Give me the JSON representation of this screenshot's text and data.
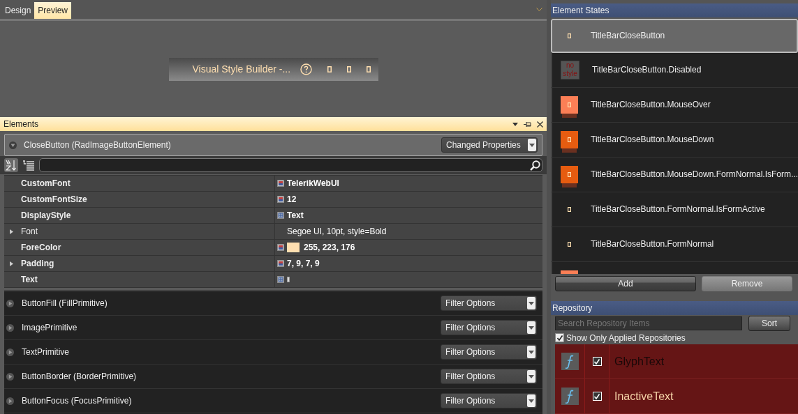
{
  "tabs": [
    {
      "label": "Design",
      "selected": false
    },
    {
      "label": "Preview",
      "selected": true
    }
  ],
  "preview": {
    "title": "Visual Style Builder -..."
  },
  "elements_panel": {
    "title": "Elements",
    "element": {
      "name": "CloseButton (RadImageButtonElement)",
      "expanded": true,
      "filter": "Changed Properties"
    },
    "properties": [
      {
        "name": "CustomFont",
        "modified": true,
        "expandable": false,
        "kind": "local",
        "value": "TelerikWebUI"
      },
      {
        "name": "CustomFontSize",
        "modified": true,
        "expandable": false,
        "kind": "local",
        "value": "12"
      },
      {
        "name": "DisplayStyle",
        "modified": true,
        "expandable": false,
        "kind": "theme",
        "value": "Text"
      },
      {
        "name": "Font",
        "modified": false,
        "expandable": true,
        "kind": "plain",
        "value": "Segoe UI, 10pt, style=Bold"
      },
      {
        "name": "ForeColor",
        "modified": true,
        "expandable": false,
        "kind": "local",
        "value": "255, 223, 176",
        "color": "#ffdfb0"
      },
      {
        "name": "Padding",
        "modified": true,
        "expandable": true,
        "kind": "local",
        "value": "7, 9, 7, 9"
      },
      {
        "name": "Text",
        "modified": true,
        "expandable": false,
        "kind": "theme",
        "glyph": true
      }
    ],
    "primitives": [
      {
        "name": "ButtonFill (FillPrimitive)",
        "filter": "Filter Options"
      },
      {
        "name": "ImagePrimitive",
        "filter": "Filter Options"
      },
      {
        "name": "TextPrimitive",
        "filter": "Filter Options"
      },
      {
        "name": "ButtonBorder (BorderPrimitive)",
        "filter": "Filter Options"
      },
      {
        "name": "ButtonFocus (FocusPrimitive)",
        "filter": "Filter Options"
      }
    ]
  },
  "element_states": {
    "title": "Element States",
    "items": [
      {
        "label": "TitleBarCloseButton",
        "kind": "plain",
        "selected": true
      },
      {
        "label": "TitleBarCloseButton.Disabled",
        "kind": "nostyle",
        "thumb_text": "no style",
        "selected": false
      },
      {
        "label": "TitleBarCloseButton.MouseOver",
        "kind": "light",
        "selected": false
      },
      {
        "label": "TitleBarCloseButton.MouseDown",
        "kind": "dark",
        "selected": false
      },
      {
        "label": "TitleBarCloseButton.MouseDown.FormNormal.IsForm...",
        "kind": "dark",
        "selected": false
      },
      {
        "label": "TitleBarCloseButton.FormNormal.IsFormActive",
        "kind": "plain",
        "selected": false
      },
      {
        "label": "TitleBarCloseButton.FormNormal",
        "kind": "plain",
        "selected": false
      },
      {
        "kind": "light",
        "selected": false
      }
    ],
    "buttons": [
      "Add",
      "Remove"
    ]
  },
  "repository": {
    "title": "Repository",
    "search": {
      "placeholder": "Search Repository Items"
    },
    "sort_button": "Sort",
    "show_only_applied": {
      "label": "Show Only Applied Repositories",
      "checked": true
    },
    "items": [
      {
        "name": "GlyphText",
        "checked": true,
        "color": "#1a0808"
      },
      {
        "name": "InactiveText",
        "checked": true,
        "color": "#f5d3a8"
      }
    ]
  }
}
